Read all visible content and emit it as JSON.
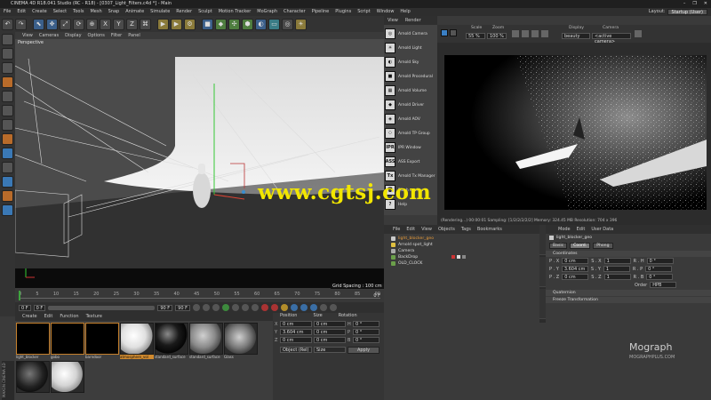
{
  "window": {
    "title": "CINEMA 4D R18.041 Studio (RC - R18) - [0307_Light_Filters.c4d *] - Main",
    "controls": [
      "–",
      "❐",
      "✕"
    ]
  },
  "menubar": {
    "items": [
      "File",
      "Edit",
      "Create",
      "Select",
      "Tools",
      "Mesh",
      "Snap",
      "Animate",
      "Simulate",
      "Render",
      "Sculpt",
      "Motion Tracker",
      "MoGraph",
      "Character",
      "Pipeline",
      "Plugins",
      "Script",
      "Window",
      "Help"
    ],
    "layout_label": "Layout:",
    "layout_value": "Startup (User)"
  },
  "viewport": {
    "menu": [
      "View",
      "Cameras",
      "Display",
      "Options",
      "Filter",
      "Panel"
    ],
    "label": "Perspective",
    "grid_spacing": "Grid Spacing : 100 cm"
  },
  "timeline": {
    "ticks": [
      "0",
      "5",
      "10",
      "15",
      "20",
      "25",
      "30",
      "35",
      "40",
      "45",
      "50",
      "55",
      "60",
      "65",
      "70",
      "75",
      "80",
      "85",
      "90"
    ],
    "start_field": "0 F",
    "current_field": "0 F",
    "end_field": "90 F",
    "end_field2": "90 F",
    "frame_readout": "0 F"
  },
  "material_manager": {
    "menu": [
      "Create",
      "Edit",
      "Function",
      "Texture"
    ],
    "materials": [
      {
        "name": "light_blocker",
        "swatch": "#000000",
        "selected": false
      },
      {
        "name": "gobo",
        "swatch": "#000000",
        "selected": false
      },
      {
        "name": "barndoor",
        "swatch": "#000000",
        "selected": false
      },
      {
        "name": "atmosphere_vol",
        "swatch": "#e6e6e6",
        "selected": true
      },
      {
        "name": "standard_surface",
        "swatch": "#111111",
        "selected": false
      },
      {
        "name": "standard_surface",
        "swatch": "#888888",
        "selected": false
      },
      {
        "name": "Glass",
        "swatch": "#9a9a9a",
        "selected": false
      },
      {
        "name": "",
        "swatch": "#333333",
        "selected": false
      },
      {
        "name": "",
        "swatch": "#cccccc",
        "selected": false
      }
    ]
  },
  "coordinates": {
    "headers": [
      "Position",
      "Size",
      "Rotation"
    ],
    "rows": [
      {
        "axis": "X",
        "pos": "0 cm",
        "size": "0 cm",
        "rot_axis": "H",
        "rot": "0 °"
      },
      {
        "axis": "Y",
        "pos": "3.604 cm",
        "size": "0 cm",
        "rot_axis": "P",
        "rot": "0 °"
      },
      {
        "axis": "Z",
        "pos": "0 cm",
        "size": "0 cm",
        "rot_axis": "B",
        "rot": "0 °"
      }
    ],
    "mode": "Object (Rel)",
    "size_mode": "Size",
    "apply": "Apply"
  },
  "render_view": {
    "menu": [
      "View",
      "Render"
    ],
    "scale_label": "Scale",
    "scale_value": "55 %",
    "zoom_label": "Zoom",
    "zoom_value": "100 %",
    "display_label": "Display",
    "display_value": "beauty",
    "camera_label": "Camera",
    "camera_value": "<active camera>",
    "status": "(Rendering...) 00:00:01  Sampling: [1/2/2/2/2/2]  Memory: 324.45 MB  Resolution: 704 x 396"
  },
  "arnold_palette": {
    "items": [
      {
        "icon": "camera-icon",
        "glyph": "◎",
        "label": "Arnold Camera"
      },
      {
        "icon": "light-bulb-icon",
        "glyph": "☀",
        "label": "Arnold Light"
      },
      {
        "icon": "sky-icon",
        "glyph": "◐",
        "label": "Arnold Sky"
      },
      {
        "icon": "cube-icon",
        "glyph": "■",
        "label": "Arnold Procedural"
      },
      {
        "icon": "volume-icon",
        "glyph": "▦",
        "label": "Arnold Volume"
      },
      {
        "icon": "driver-icon",
        "glyph": "◆",
        "label": "Arnold Driver"
      },
      {
        "icon": "aov-icon",
        "glyph": "◈",
        "label": "Arnold AOV"
      },
      {
        "icon": "tp-group-icon",
        "glyph": "⁘",
        "label": "Arnold TP Group"
      },
      {
        "icon": "ipr-icon",
        "glyph": "IPR",
        "label": "IPR Window"
      },
      {
        "icon": "ass-export-icon",
        "glyph": "ASS",
        "label": "ASS Export"
      },
      {
        "icon": "tx-icon",
        "glyph": "Tx",
        "label": "Arnold Tx Manager"
      },
      {
        "icon": "trash-icon",
        "glyph": "🗑",
        "label": "Flush caches"
      },
      {
        "icon": "help-icon",
        "glyph": "?",
        "label": "Help"
      }
    ]
  },
  "object_manager": {
    "menu": [
      "File",
      "Edit",
      "View",
      "Objects",
      "Tags",
      "Bookmarks"
    ],
    "objects": [
      {
        "name": "light_blocker_geo",
        "selected": true
      },
      {
        "name": "Arnold spot_light",
        "selected": false
      },
      {
        "name": "Camera",
        "selected": false
      },
      {
        "name": "BackDrop",
        "selected": false
      },
      {
        "name": "OLD_CLOCK",
        "selected": false
      }
    ]
  },
  "attributes": {
    "menu": [
      "Mode",
      "Edit",
      "User Data"
    ],
    "object_name": "light_blocker_geo",
    "tabs": [
      "Basic",
      "Coord.",
      "Phong"
    ],
    "active_tab": "Coord.",
    "section": "Coordinates",
    "rows": [
      {
        "a": "P . X",
        "av": "0 cm",
        "b": "S . X",
        "bv": "1",
        "c": "R . H",
        "cv": "0 °"
      },
      {
        "a": "P . Y",
        "av": "3.604 cm",
        "b": "S . Y",
        "bv": "1",
        "c": "R . P",
        "cv": "0 °"
      },
      {
        "a": "P . Z",
        "av": "0 cm",
        "b": "S . Z",
        "bv": "1",
        "c": "R . B",
        "cv": "0 °"
      }
    ],
    "order_label": "Order",
    "order_value": "HPB",
    "collapsed": [
      "Quaternion",
      "Freeze Transformation"
    ]
  },
  "overlays": {
    "watermark": "www.cgtsj.com",
    "brand": "Mograph",
    "brand_sub": "MOGRAPHPLUS.COM",
    "c4d_logo": "MAXON CINEMA 4D"
  },
  "colors": {
    "accent_orange": "#d08a2e",
    "selection_orange": "#e59a3a",
    "watermark_yellow": "#f2e600"
  }
}
